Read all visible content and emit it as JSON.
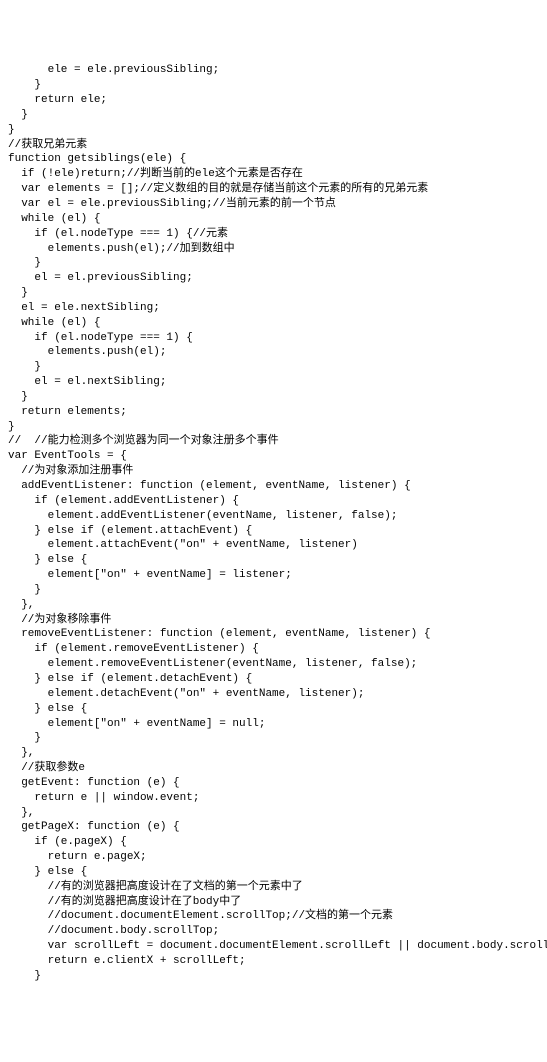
{
  "code": {
    "lines": [
      "      ele = ele.previousSibling;",
      "    }",
      "    return ele;",
      "  }",
      "}",
      "//获取兄弟元素",
      "function getsiblings(ele) {",
      "  if (!ele)return;//判断当前的ele这个元素是否存在",
      "  var elements = [];//定义数组的目的就是存储当前这个元素的所有的兄弟元素",
      "  var el = ele.previousSibling;//当前元素的前一个节点",
      "  while (el) {",
      "    if (el.nodeType === 1) {//元素",
      "      elements.push(el);//加到数组中",
      "    }",
      "    el = el.previousSibling;",
      "  }",
      "  el = ele.nextSibling;",
      "  while (el) {",
      "    if (el.nodeType === 1) {",
      "      elements.push(el);",
      "    }",
      "    el = el.nextSibling;",
      "  }",
      "  return elements;",
      "}",
      "//  //能力检测多个浏览器为同一个对象注册多个事件",
      "var EventTools = {",
      "  //为对象添加注册事件",
      "  addEventListener: function (element, eventName, listener) {",
      "    if (element.addEventListener) {",
      "      element.addEventListener(eventName, listener, false);",
      "    } else if (element.attachEvent) {",
      "      element.attachEvent(\"on\" + eventName, listener)",
      "    } else {",
      "      element[\"on\" + eventName] = listener;",
      "    }",
      "  },",
      "  //为对象移除事件",
      "  removeEventListener: function (element, eventName, listener) {",
      "    if (element.removeEventListener) {",
      "      element.removeEventListener(eventName, listener, false);",
      "    } else if (element.detachEvent) {",
      "      element.detachEvent(\"on\" + eventName, listener);",
      "    } else {",
      "      element[\"on\" + eventName] = null;",
      "    }",
      "  },",
      "  //获取参数e",
      "  getEvent: function (e) {",
      "    return e || window.event;",
      "  },",
      "  getPageX: function (e) {",
      "    if (e.pageX) {",
      "      return e.pageX;",
      "    } else {",
      "      //有的浏览器把高度设计在了文档的第一个元素中了",
      "      //有的浏览器把高度设计在了body中了",
      "      //document.documentElement.scrollTop;//文档的第一个元素",
      "      //document.body.scrollTop;",
      "      var scrollLeft = document.documentElement.scrollLeft || document.body.scrollLeft;",
      "      return e.clientX + scrollLeft;",
      "    }"
    ]
  }
}
